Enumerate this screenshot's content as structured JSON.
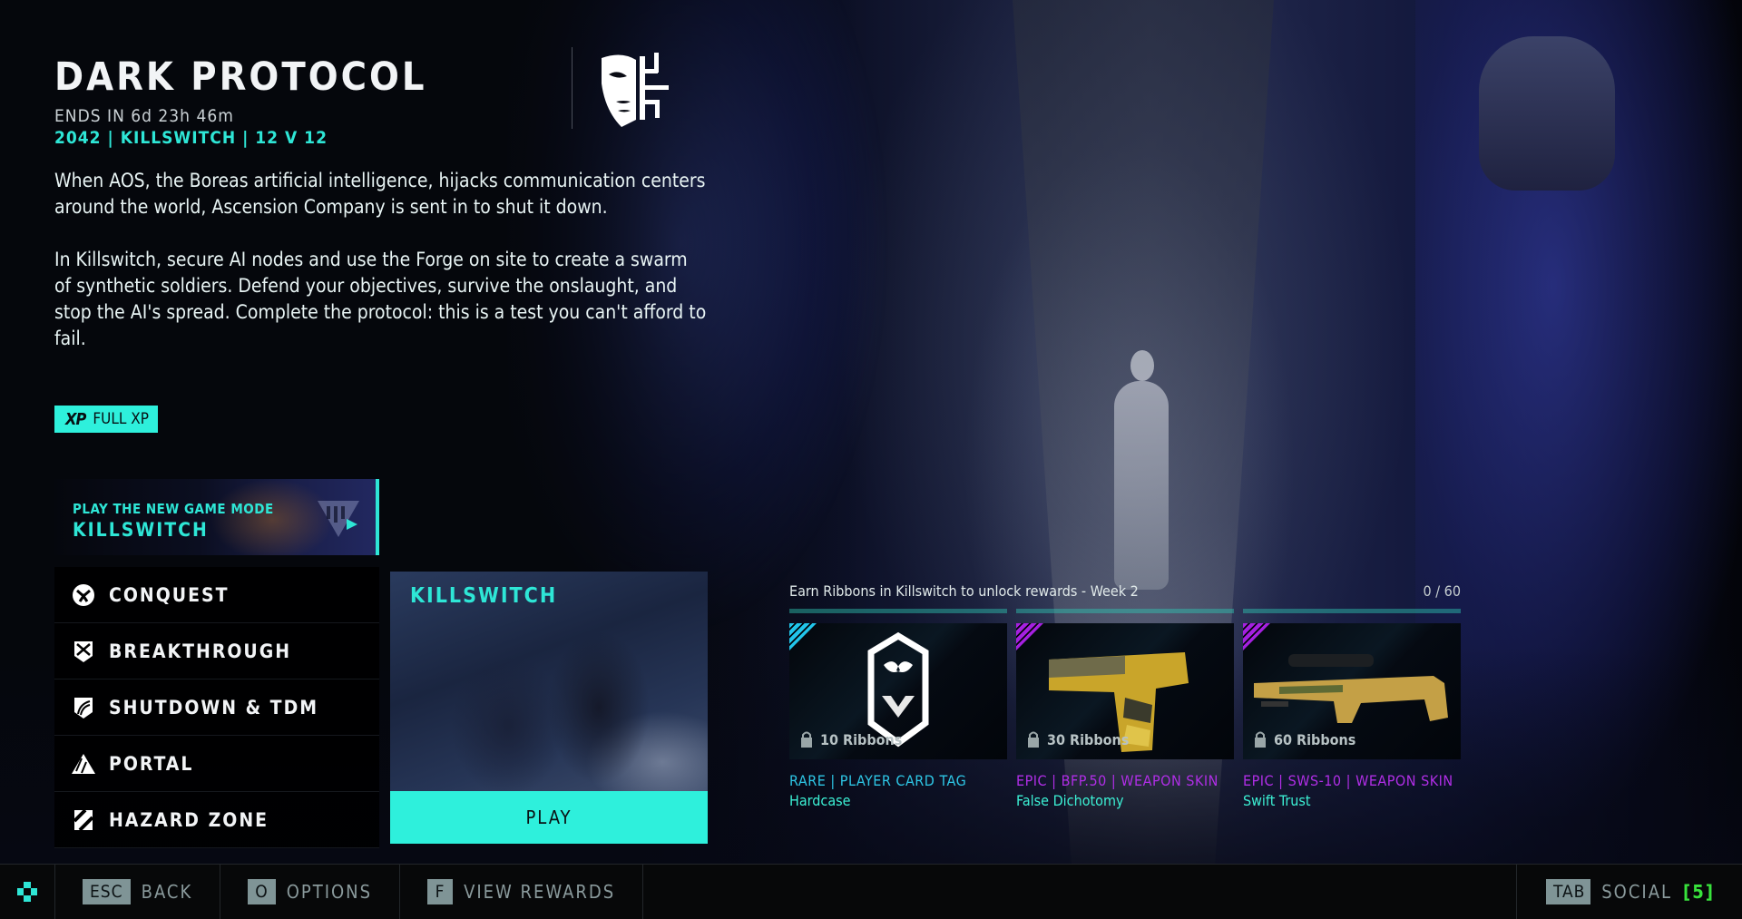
{
  "event": {
    "title": "DARK PROTOCOL",
    "ends_in": "ENDS IN 6d 23h 46m",
    "meta": "2042 | KILLSWITCH | 12 V 12",
    "emblem_icon": "mask-circuit-emblem",
    "description": [
      "When AOS, the Boreas artificial intelligence, hijacks communication centers around the world, Ascension Company is sent in to shut it down.",
      "In Killswitch, secure AI nodes and use the Forge on site to create a swarm of synthetic soldiers. Defend your objectives, survive the onslaught, and stop the AI's spread. Complete the protocol: this is a test you can't afford to fail."
    ],
    "xp_badge": {
      "icon": "XP",
      "label": "FULL XP"
    }
  },
  "promo": {
    "small": "PLAY THE NEW GAME MODE",
    "big": "KILLSWITCH",
    "accent": "#2ee6d6"
  },
  "modes": [
    {
      "label": "CONQUEST",
      "icon": "conquest-icon"
    },
    {
      "label": "BREAKTHROUGH",
      "icon": "breakthrough-icon"
    },
    {
      "label": "SHUTDOWN & TDM",
      "icon": "shutdown-icon"
    },
    {
      "label": "PORTAL",
      "icon": "portal-icon"
    },
    {
      "label": "HAZARD ZONE",
      "icon": "hazard-zone-icon"
    }
  ],
  "featured": {
    "title": "KILLSWITCH",
    "play_label": "PLAY"
  },
  "rewards": {
    "heading": "Earn Ribbons in Killswitch to unlock rewards - Week 2",
    "progress_text": "0 / 60",
    "progress_value": 0,
    "progress_max": 60,
    "tiers_fill": [
      0,
      0,
      0
    ],
    "items": [
      {
        "requirement": "10 Ribbons",
        "rarity_line": "RARE  |  PLAYER CARD TAG",
        "name": "Hardcase",
        "rarity_color": "#2ec7e6",
        "corner_color": "#21c5ea",
        "art": "player-card-tag-icon"
      },
      {
        "requirement": "30 Ribbons",
        "rarity_line": "EPIC  |  BFP.50  |  WEAPON SKIN",
        "name": "False Dichotomy",
        "rarity_color": "#b02ee6",
        "corner_color": "#a520e0",
        "art": "pistol-skin-icon"
      },
      {
        "requirement": "60 Ribbons",
        "rarity_line": "EPIC  |  SWS-10  |  WEAPON SKIN",
        "name": "Swift Trust",
        "rarity_color": "#b02ee6",
        "corner_color": "#a520e0",
        "art": "sniper-skin-icon"
      }
    ]
  },
  "footer": {
    "back": {
      "key": "ESC",
      "label": "BACK"
    },
    "options": {
      "key": "O",
      "label": "OPTIONS"
    },
    "view_rewards": {
      "key": "F",
      "label": "VIEW REWARDS"
    },
    "social": {
      "key": "TAB",
      "label": "SOCIAL",
      "count": "[5]"
    }
  },
  "colors": {
    "accent": "#2ee6d6",
    "epic": "#b02ee6",
    "rare": "#2ec7e6",
    "social_count": "#38e23c"
  }
}
